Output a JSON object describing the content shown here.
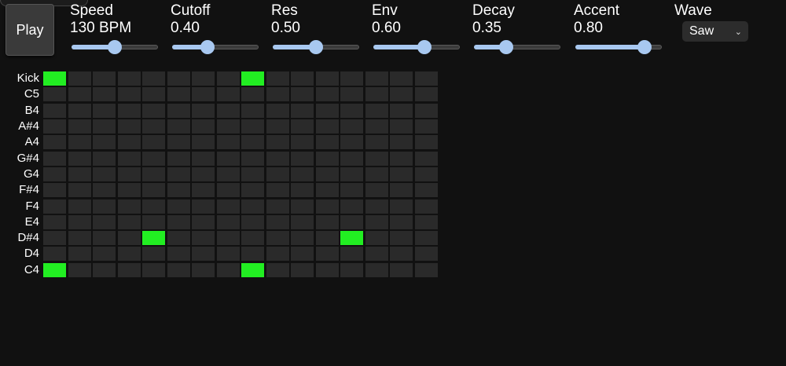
{
  "play_label": "Play",
  "controls": [
    {
      "label": "Speed",
      "value": "130 BPM",
      "level": 0.5
    },
    {
      "label": "Cutoff",
      "value": "0.40",
      "level": 0.41
    },
    {
      "label": "Res",
      "value": "0.50",
      "level": 0.5
    },
    {
      "label": "Env",
      "value": "0.60",
      "level": 0.59
    },
    {
      "label": "Decay",
      "value": "0.35",
      "level": 0.37
    },
    {
      "label": "Accent",
      "value": "0.80",
      "level": 0.8
    }
  ],
  "wave": {
    "label": "Wave",
    "selected": "Saw"
  },
  "grid": {
    "steps": 16,
    "rows": [
      {
        "label": "Kick",
        "active": [
          0,
          8
        ]
      },
      {
        "label": "C5",
        "active": []
      },
      {
        "label": "B4",
        "active": []
      },
      {
        "label": "A#4",
        "active": []
      },
      {
        "label": "A4",
        "active": []
      },
      {
        "label": "G#4",
        "active": []
      },
      {
        "label": "G4",
        "active": []
      },
      {
        "label": "F#4",
        "active": []
      },
      {
        "label": "F4",
        "active": []
      },
      {
        "label": "E4",
        "active": []
      },
      {
        "label": "D#4",
        "active": [
          4,
          12
        ]
      },
      {
        "label": "D4",
        "active": []
      },
      {
        "label": "C4",
        "active": [
          0,
          8
        ]
      }
    ]
  },
  "colors": {
    "background": "#111111",
    "cell_off": "#2a2a2a",
    "cell_on": "#22ee22",
    "slider_accent": "#a8c8f0"
  }
}
